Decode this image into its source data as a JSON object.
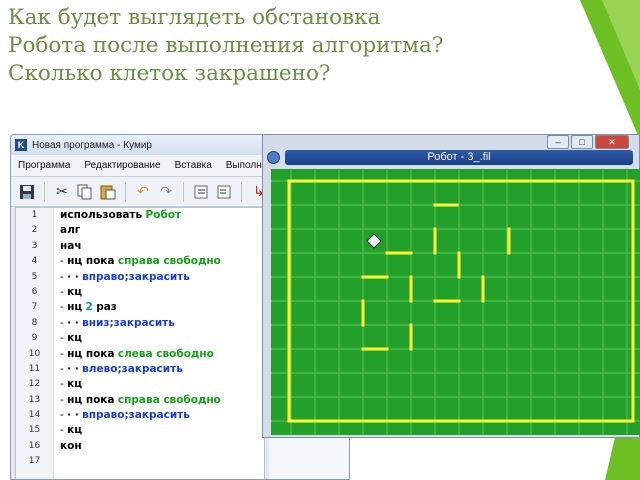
{
  "question": {
    "lines": [
      "Как будет выглядеть обстановка",
      "Робота после выполнения алгоритма?",
      "Сколько клеток закрашено?"
    ]
  },
  "colors": {
    "question_text": "#6a8f43",
    "field_bg": "#22a02a",
    "grid": "#5ec45e",
    "wall": "#ffff33"
  },
  "editor": {
    "app_icon": "K",
    "title": "Новая программа - Кумир",
    "menu": [
      "Программа",
      "Редактирование",
      "Вставка",
      "Выполнение"
    ],
    "toolbar_icons": [
      "save-icon",
      "cut-icon",
      "copy-icon",
      "paste-icon",
      "undo-icon",
      "redo-icon",
      "indent-icon",
      "unindent-icon",
      "run-icon",
      "step-icon"
    ],
    "line_numbers": [
      "1",
      "2",
      "3",
      "4",
      "5",
      "6",
      "7",
      "8",
      "9",
      "10",
      "11",
      "12",
      "13",
      "14",
      "15",
      "16",
      "17"
    ],
    "code": {
      "l1": {
        "a": "использовать",
        "b": "Робот"
      },
      "l2": "алг",
      "l3": "нач",
      "l4": {
        "a": "нц пока",
        "b": "справа свободно"
      },
      "l5": {
        "a": "· ·",
        "b": "вправо;закрасить"
      },
      "l6": "кц",
      "l7": {
        "a": "нц",
        "n": "2",
        "b": "раз"
      },
      "l8": {
        "a": "· ·",
        "b": "вниз;закрасить"
      },
      "l9": "кц",
      "l10": {
        "a": "нц пока",
        "b": "слева свободно"
      },
      "l11": {
        "a": "· ·",
        "b": "влево;закрасить"
      },
      "l12": "кц",
      "l13": {
        "a": "нц пока",
        "b": "справа свободно"
      },
      "l14": {
        "a": "· ·",
        "b": "вправо;закрасить"
      },
      "l15": "кц",
      "l16": "кон"
    }
  },
  "robot": {
    "title": "Робот - 3_.fil",
    "frame_buttons": [
      "minimize",
      "maximize",
      "close"
    ],
    "close_label": "✕",
    "maximize_label": "□",
    "minimize_label": "–"
  }
}
